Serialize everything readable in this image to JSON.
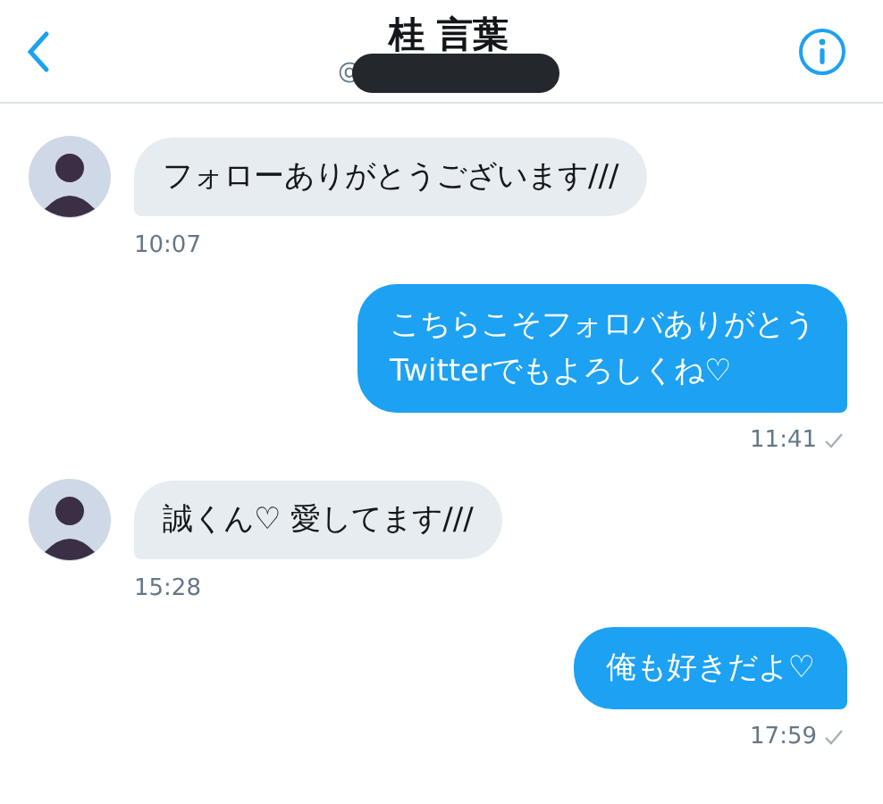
{
  "header": {
    "title": "桂 言葉",
    "handle": "@",
    "handle_redacted": true
  },
  "messages": [
    {
      "kind": "received",
      "lines": [
        "フォローありがとうございます///"
      ],
      "time": "10:07"
    },
    {
      "kind": "sent",
      "lines": [
        "こちらこそフォロバありがとう",
        "Twitterでもよろしくね♡"
      ],
      "time": "11:41",
      "read": true
    },
    {
      "kind": "received",
      "lines": [
        "誠くん♡ 愛してます///"
      ],
      "time": "15:28"
    },
    {
      "kind": "sent",
      "lines": [
        "俺も好きだよ♡"
      ],
      "time": "17:59",
      "read": true
    }
  ]
}
